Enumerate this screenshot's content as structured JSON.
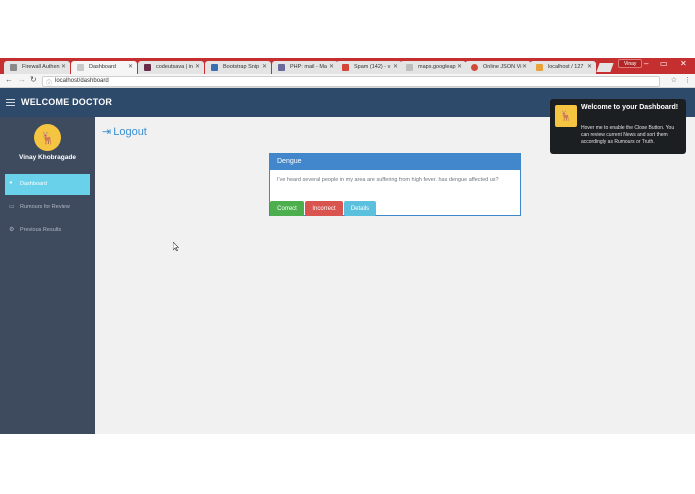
{
  "browser": {
    "tabs": [
      {
        "label": "Firewall Authen",
        "active": false
      },
      {
        "label": "Dashboard",
        "active": true
      },
      {
        "label": "codeutsava | in",
        "active": false
      },
      {
        "label": "Bootstrap Snip",
        "active": false
      },
      {
        "label": "PHP: mail - Ma",
        "active": false
      },
      {
        "label": "Spam (142) - v",
        "active": false
      },
      {
        "label": "maps.googleap",
        "active": false
      },
      {
        "label": "Online JSON Vi",
        "active": false
      },
      {
        "label": "localhost / 127",
        "active": false
      }
    ],
    "profile_label": "Vinay",
    "url": "localhost/dashboard",
    "minimize": "–",
    "maximize": "▭",
    "close": "✕",
    "back": "←",
    "forward": "→",
    "reload": "↻",
    "info_icon": "ⓘ",
    "star": "☆",
    "menu": "⋮"
  },
  "header": {
    "title": "WELCOME DOCTOR"
  },
  "sidebar": {
    "avatar_glyph": "🦌",
    "username": "Vinay Khobragade",
    "items": [
      {
        "label": "Dashboard",
        "icon": "dashboard-icon",
        "glyph": "◕",
        "active": true
      },
      {
        "label": "Rumours for Review",
        "icon": "monitor-icon",
        "glyph": "▭",
        "active": false
      },
      {
        "label": "Previous Results",
        "icon": "gears-icon",
        "glyph": "⚙",
        "active": false
      }
    ]
  },
  "main": {
    "logout_label": "Logout",
    "logout_glyph": "⇥",
    "card": {
      "title": "Dengue",
      "body": "I've heard several people in my area are suffering from high fever. has dengue affected us?",
      "buttons": {
        "correct": "Correct",
        "incorrect": "Incorrect",
        "details": "Details"
      }
    }
  },
  "toast": {
    "icon_glyph": "🦌",
    "title": "Welcome to your Dashboard!",
    "body": "Hover me to enable the Close Button. You can review current News and sort them accordingly as Rumours or Truth."
  },
  "colors": {
    "header_bg": "#2e4a6a",
    "sidebar_bg": "#3e4b5e",
    "active_nav": "#6ad1ea",
    "card_header": "#4287cb",
    "correct": "#4cae4c",
    "incorrect": "#d9534f",
    "details": "#5bc0de",
    "browser_frame": "#c62f2f"
  }
}
